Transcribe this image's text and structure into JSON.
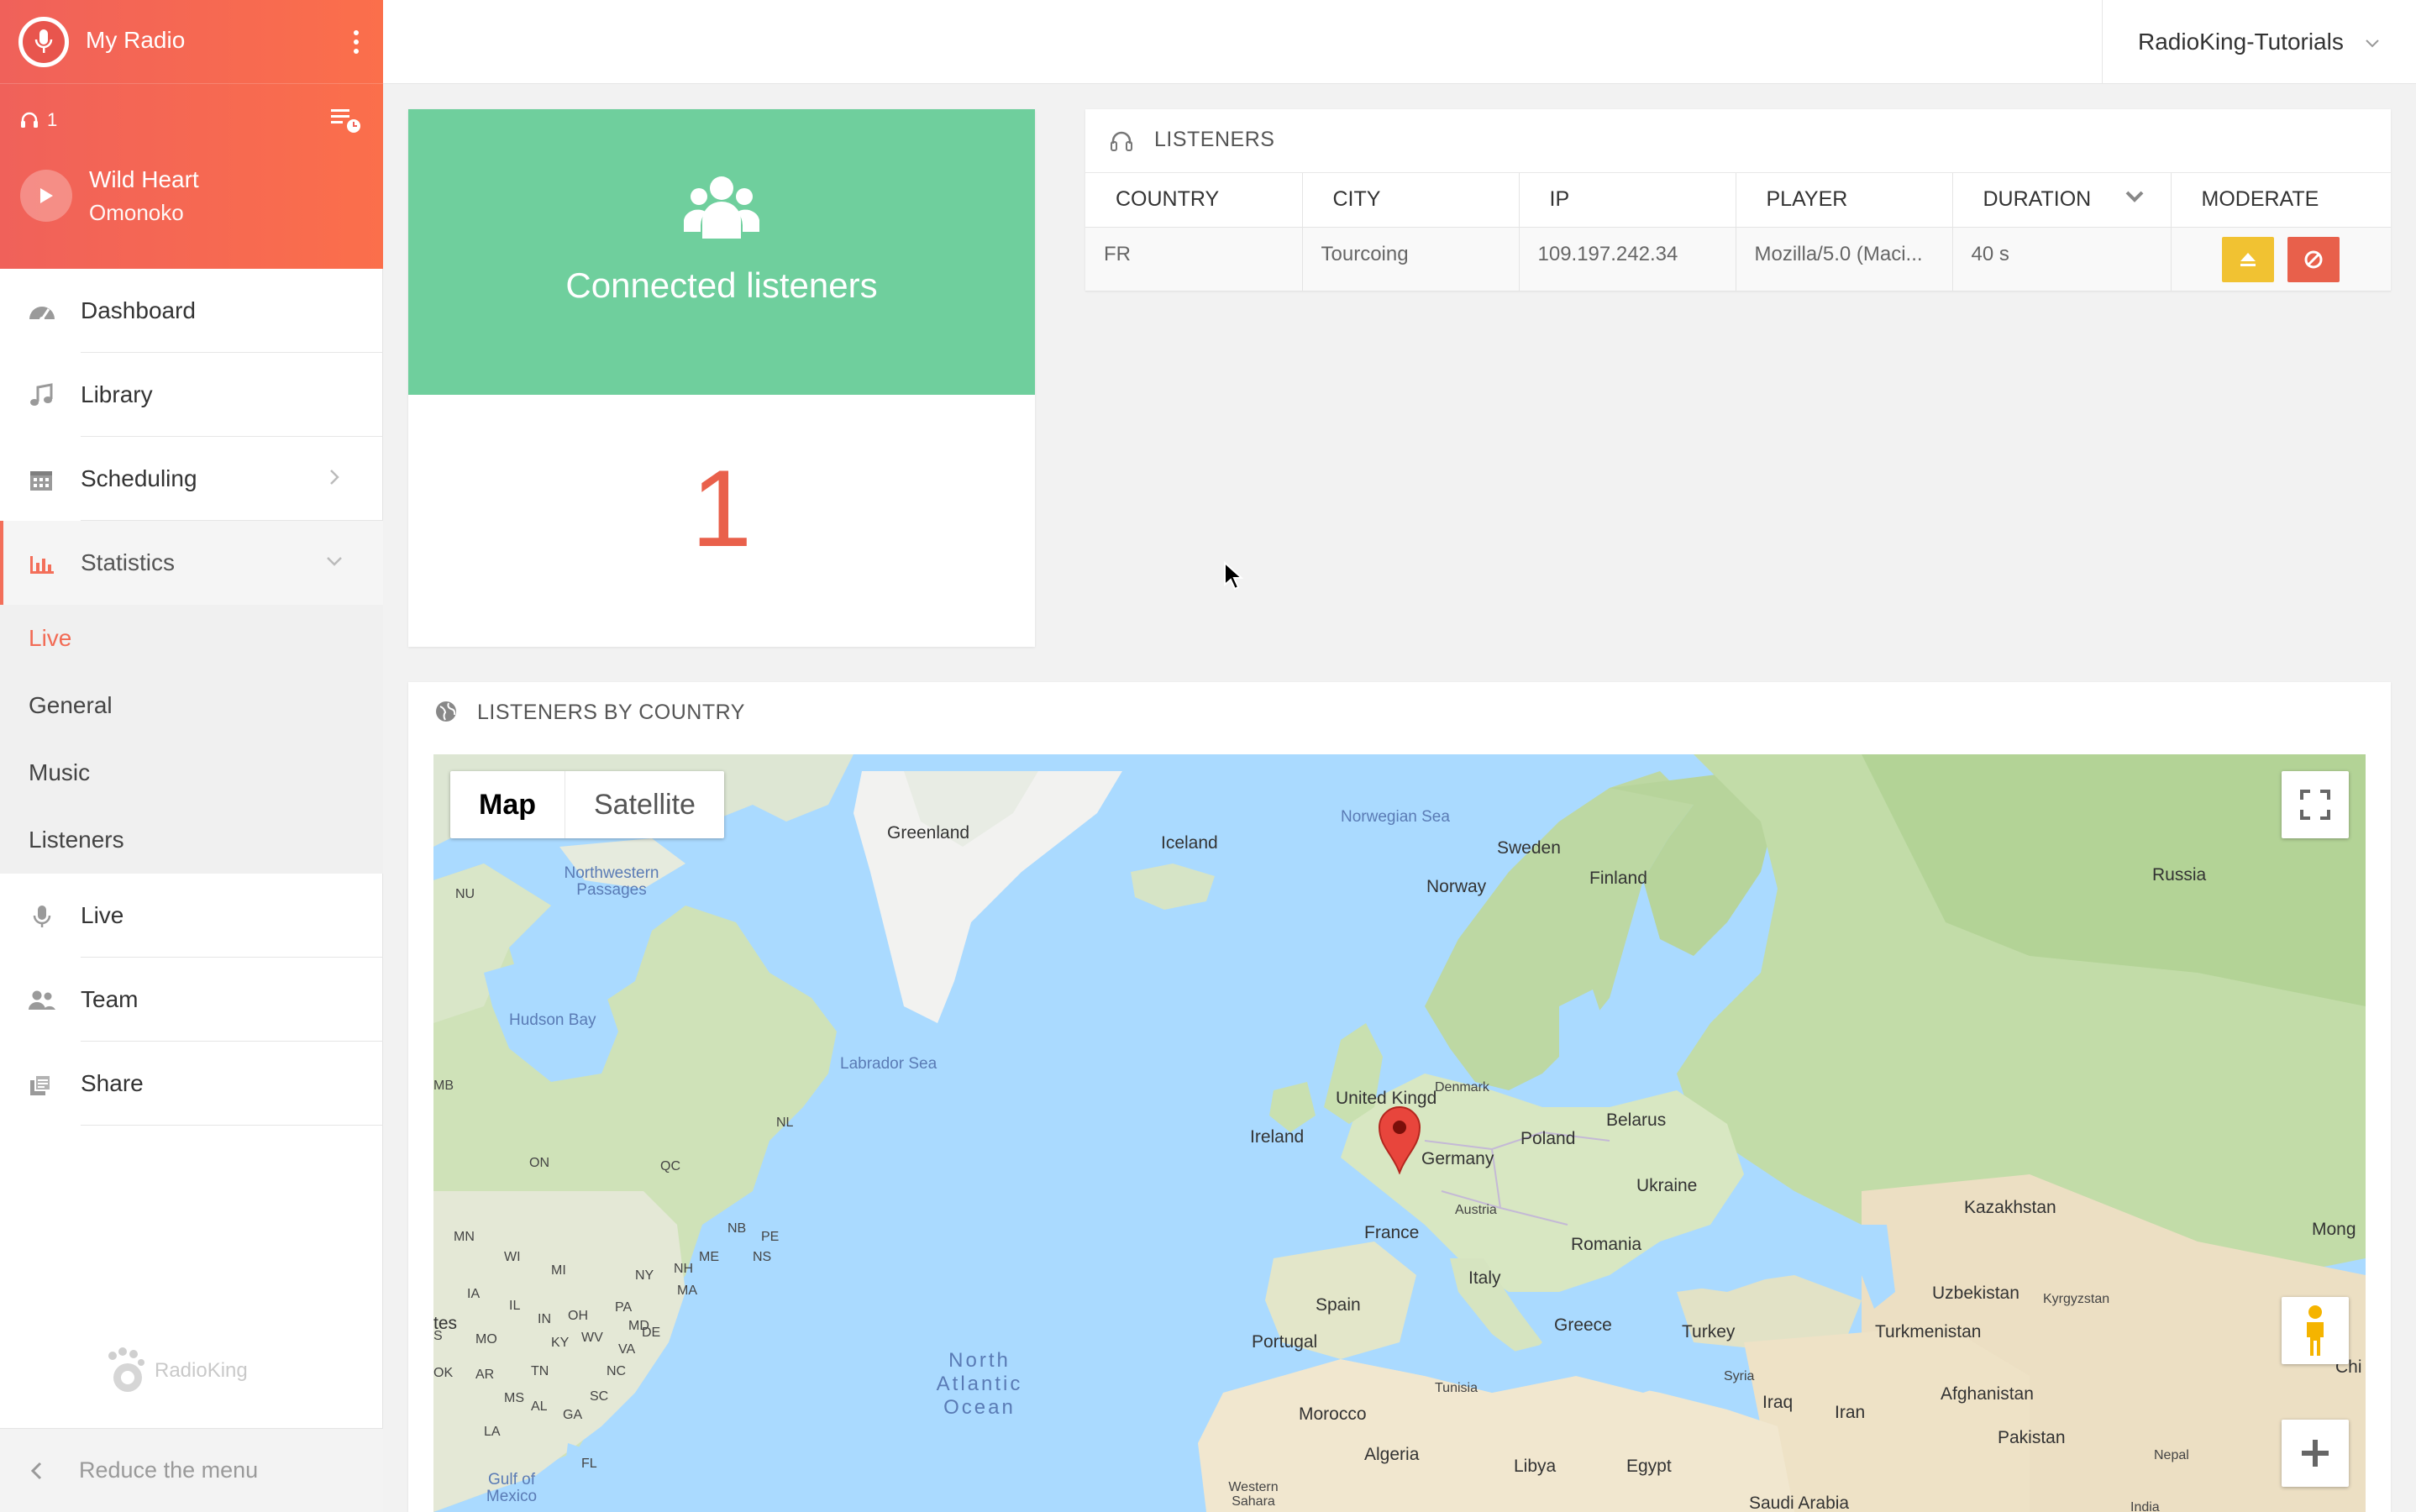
{
  "sidebar": {
    "radio_name": "My Radio",
    "listeners_count": "1",
    "now_playing": {
      "title": "Wild Heart",
      "artist": "Omonoko"
    },
    "nav": [
      {
        "label": "Dashboard",
        "icon": "dashboard-icon"
      },
      {
        "label": "Library",
        "icon": "music-note-icon"
      },
      {
        "label": "Scheduling",
        "icon": "calendar-icon"
      },
      {
        "label": "Statistics",
        "icon": "bar-chart-icon"
      }
    ],
    "statistics_sub": [
      "Live",
      "General",
      "Music",
      "Listeners"
    ],
    "nav_bottom": [
      {
        "label": "Live",
        "icon": "microphone-icon"
      },
      {
        "label": "Team",
        "icon": "team-icon"
      },
      {
        "label": "Share",
        "icon": "share-icon"
      }
    ],
    "brand": "RadioKing",
    "reduce_label": "Reduce the menu"
  },
  "topbar": {
    "account": "RadioKing-Tutorials"
  },
  "connected": {
    "title": "Connected listeners",
    "count": "1"
  },
  "listeners_table": {
    "title": "LISTENERS",
    "columns": [
      "COUNTRY",
      "CITY",
      "IP",
      "PLAYER",
      "DURATION",
      "MODERATE"
    ],
    "rows": [
      {
        "country": "FR",
        "city": "Tourcoing",
        "ip": "109.197.242.34",
        "player": "Mozilla/5.0 (Maci...",
        "duration": "40 s"
      }
    ]
  },
  "map_card": {
    "title": "LISTENERS BY COUNTRY",
    "map_type": {
      "map": "Map",
      "satellite": "Satellite"
    },
    "labels": {
      "greenland": "Greenland",
      "iceland": "Iceland",
      "norwegian_sea": "Norwegian Sea",
      "sweden": "Sweden",
      "finland": "Finland",
      "norway": "Norway",
      "russia": "Russia",
      "nw_passages": "Northwestern Passages",
      "nu": "NU",
      "hudson_bay": "Hudson Bay",
      "labrador_sea": "Labrador Sea",
      "mb": "MB",
      "nl": "NL",
      "on": "ON",
      "qc": "QC",
      "denmark": "Denmark",
      "united_kingdom": "United Kingd",
      "ireland": "Ireland",
      "belarus": "Belarus",
      "poland": "Poland",
      "germany": "Germany",
      "ukraine": "Ukraine",
      "kazakhstan": "Kazakhstan",
      "mong": "Mong",
      "austria": "Austria",
      "france": "France",
      "romania": "Romania",
      "italy": "Italy",
      "uzbekistan": "Uzbekistan",
      "kyrgyzstan": "Kyrgyzstan",
      "spain": "Spain",
      "greece": "Greece",
      "turkey": "Turkey",
      "turkmenistan": "Turkmenistan",
      "portugal": "Portugal",
      "north_atlantic": "North Atlantic Ocean",
      "syria": "Syria",
      "iraq": "Iraq",
      "iran": "Iran",
      "afghanistan": "Afghanistan",
      "tunisia": "Tunisia",
      "morocco": "Morocco",
      "pakistan": "Pakistan",
      "nepal": "Nepal",
      "algeria": "Algeria",
      "libya": "Libya",
      "egypt": "Egypt",
      "western_sahara": "Western Sahara",
      "saudi_arabia": "Saudi Arabia",
      "gulf_mexico": "Gulf of Mexico",
      "chi": "Chi",
      "tes": "tes",
      "india": "India",
      "us_states": [
        "MN",
        "WI",
        "MI",
        "IA",
        "IL",
        "IN",
        "OH",
        "PA",
        "NY",
        "MO",
        "KY",
        "WV",
        "VA",
        "OK",
        "AR",
        "TN",
        "NC",
        "MS",
        "AL",
        "GA",
        "SC",
        "LA",
        "FL",
        "MD",
        "DE",
        "NH",
        "MA",
        "ME",
        "NB",
        "PE",
        "NS",
        "S"
      ]
    }
  },
  "colors": {
    "accent": "#f36f5a",
    "connected_green": "#6fcf9d",
    "count_red": "#e9604b",
    "eject_yellow": "#f1c232",
    "ban_red": "#e8604b"
  }
}
